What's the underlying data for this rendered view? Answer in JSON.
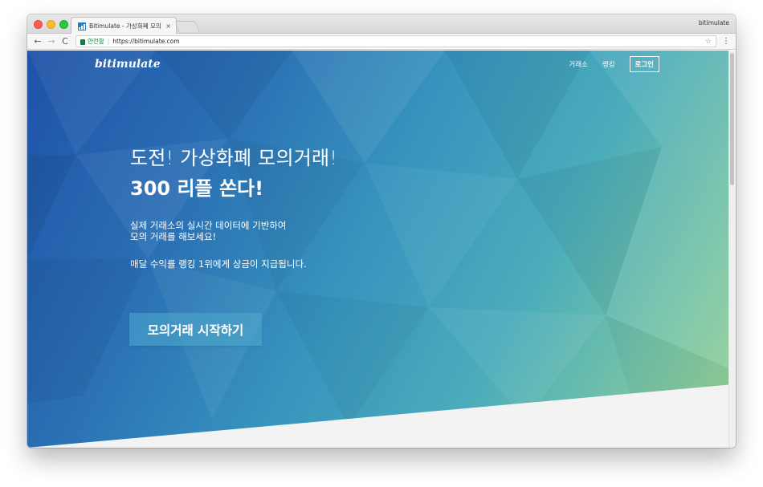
{
  "browser": {
    "tab_title": "Bitimulate - 가상화폐 모의 거래소",
    "tab_close": "×",
    "profile_name": "bitimulate",
    "secure_label": "안전함",
    "url": "https://bitimulate.com",
    "back_glyph": "←",
    "forward_glyph": "→",
    "reload_glyph": "C",
    "star_glyph": "☆",
    "menu_glyph": "⋮"
  },
  "site": {
    "brand": "bitimulate",
    "nav": {
      "exchange": "거래소",
      "ranking": "랭킹",
      "login": "로그인"
    },
    "hero": {
      "headline": "도전! 가상화폐 모의거래!",
      "headline2_bold": "300 리플",
      "headline2_rest": " 쏜다!",
      "desc_line1": "실제 거래소의 실시간 데이터에 기반하여",
      "desc_line2": "모의 거래를 해보세요!",
      "desc2": "매달 수익률 랭킹 1위에게 상금이 지급됩니다.",
      "cta": "모의거래 시작하기"
    }
  },
  "colors": {
    "hero_start": "#1f52a8",
    "hero_mid": "#3795be",
    "hero_end": "#9ed393",
    "secure_green": "#0b8043"
  },
  "icons": [
    "lock-icon",
    "star-icon",
    "menu-icon",
    "favicon-icon"
  ]
}
